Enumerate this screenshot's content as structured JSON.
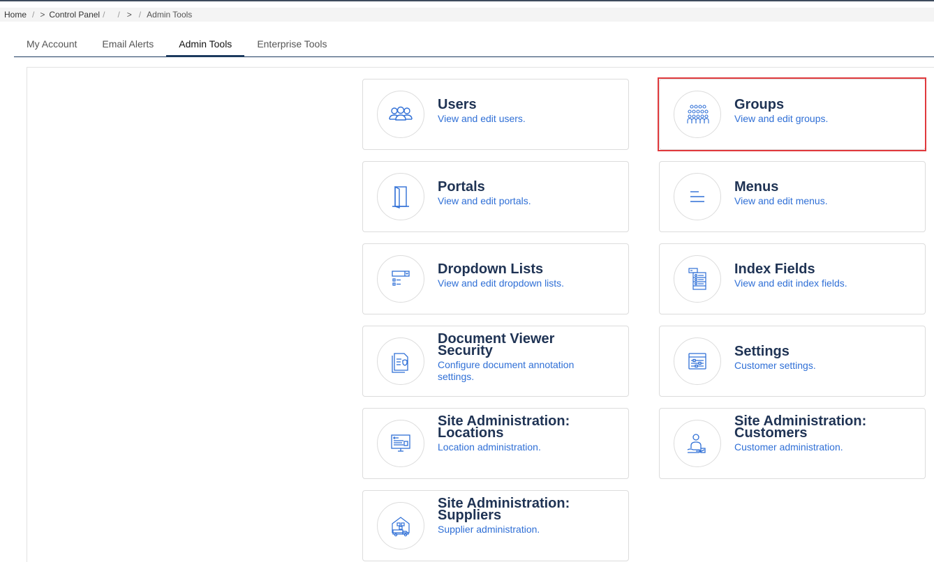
{
  "breadcrumb": {
    "home": "Home",
    "control_panel": "Control Panel",
    "current": "Admin Tools"
  },
  "tabs": [
    {
      "label": "My Account",
      "active": false
    },
    {
      "label": "Email Alerts",
      "active": false
    },
    {
      "label": "Admin Tools",
      "active": true
    },
    {
      "label": "Enterprise Tools",
      "active": false
    }
  ],
  "cards": {
    "users": {
      "title": "Users",
      "desc": "View and edit users.",
      "icon": "users-icon"
    },
    "groups": {
      "title": "Groups",
      "desc": "View and edit groups.",
      "icon": "groups-icon"
    },
    "portals": {
      "title": "Portals",
      "desc": "View and edit portals.",
      "icon": "door-icon"
    },
    "menus": {
      "title": "Menus",
      "desc": "View and edit menus.",
      "icon": "menu-lines-icon"
    },
    "dropdown_lists": {
      "title": "Dropdown Lists",
      "desc": "View and edit dropdown lists.",
      "icon": "dropdown-list-icon"
    },
    "index_fields": {
      "title": "Index Fields",
      "desc": "View and edit index fields.",
      "icon": "index-fields-icon"
    },
    "doc_viewer_security": {
      "title": "Document Viewer Security",
      "desc": "Configure document annotation settings.",
      "icon": "document-security-icon"
    },
    "settings": {
      "title": "Settings",
      "desc": "Customer settings.",
      "icon": "settings-panel-icon"
    },
    "site_locations": {
      "title": "Site Administration: Locations",
      "desc": "Location administration.",
      "icon": "monitor-chart-icon"
    },
    "site_customers": {
      "title": "Site Administration: Customers",
      "desc": "Customer administration.",
      "icon": "customer-hand-icon"
    },
    "site_suppliers": {
      "title": "Site Administration: Suppliers",
      "desc": "Supplier administration.",
      "icon": "warehouse-truck-icon"
    }
  },
  "colors": {
    "title": "#1f3354",
    "link": "#2f6fd6",
    "icon": "#2f6fd6",
    "highlight": "#e0393c",
    "tab_underline": "#1c3a5e"
  }
}
